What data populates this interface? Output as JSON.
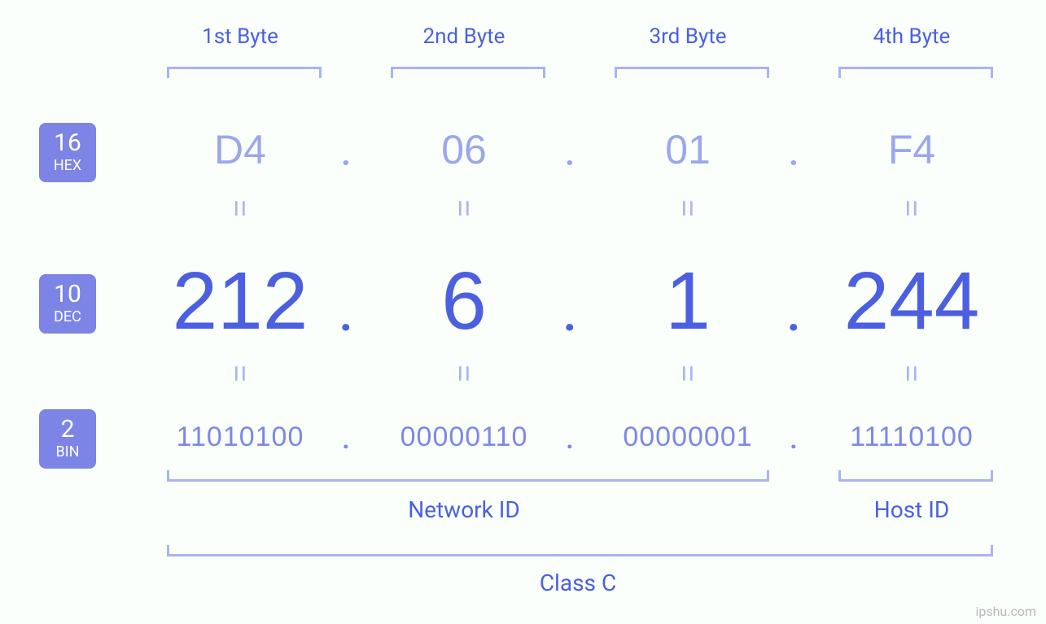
{
  "headers": {
    "b1": "1st Byte",
    "b2": "2nd Byte",
    "b3": "3rd Byte",
    "b4": "4th Byte"
  },
  "badges": {
    "hex_num": "16",
    "hex_lbl": "HEX",
    "dec_num": "10",
    "dec_lbl": "DEC",
    "bin_num": "2",
    "bin_lbl": "BIN"
  },
  "hex": {
    "b1": "D4",
    "b2": "06",
    "b3": "01",
    "b4": "F4"
  },
  "dec": {
    "b1": "212",
    "b2": "6",
    "b3": "1",
    "b4": "244"
  },
  "bin": {
    "b1": "11010100",
    "b2": "00000110",
    "b3": "00000001",
    "b4": "11110100"
  },
  "sep": {
    "dot": ".",
    "eq": "="
  },
  "labels": {
    "network_id": "Network ID",
    "host_id": "Host ID",
    "class": "Class C"
  },
  "watermark": "ipshu.com"
}
